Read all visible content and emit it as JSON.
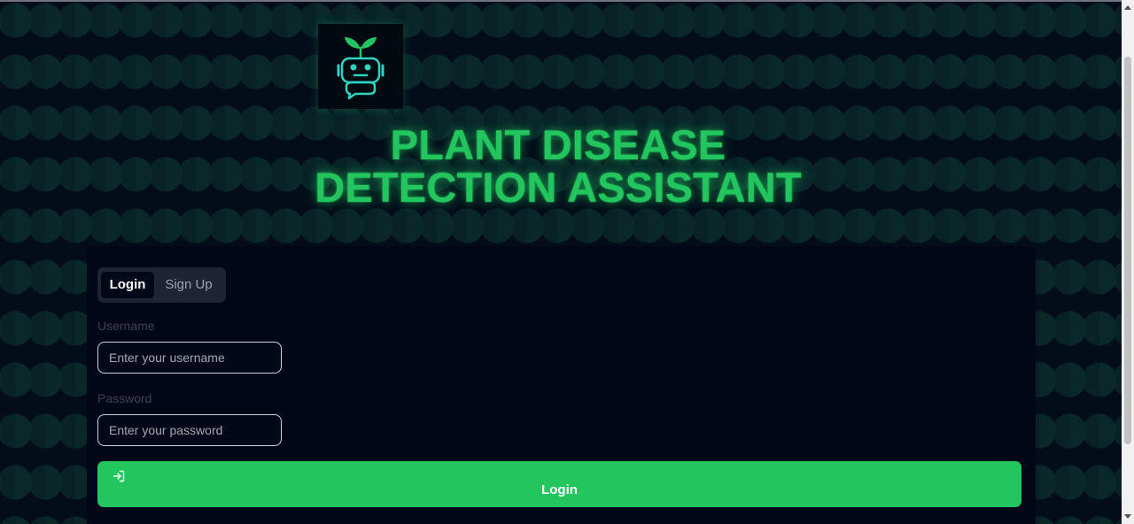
{
  "app": {
    "title_line1": "PLANT DISEASE",
    "title_line2": "DETECTION ASSISTANT",
    "logo_icon": "plant-robot-chat-icon"
  },
  "auth_tabs": {
    "login_label": "Login",
    "signup_label": "Sign Up",
    "active": "Login"
  },
  "form": {
    "username_label": "Username",
    "username_placeholder": "Enter your username",
    "username_value": "",
    "password_label": "Password",
    "password_placeholder": "Enter your password",
    "password_value": "",
    "submit_label": "Login",
    "submit_icon": "log-in-icon"
  },
  "colors": {
    "accent": "#22c55e",
    "background": "#030d1a",
    "card": "#010716",
    "logo_teal": "#2dd4bf"
  }
}
